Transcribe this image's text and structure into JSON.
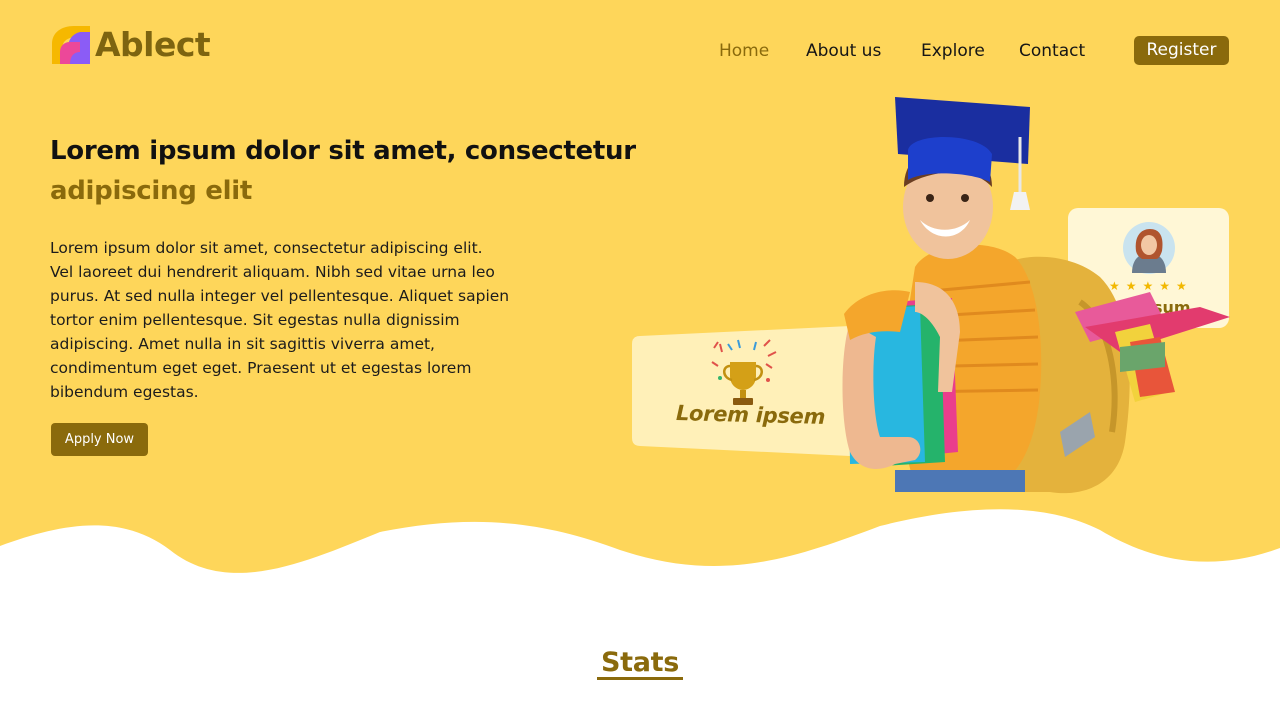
{
  "brand": {
    "name": "Ablect"
  },
  "nav": {
    "items": [
      {
        "label": "Home",
        "active": true
      },
      {
        "label": "About us",
        "active": false
      },
      {
        "label": "Explore",
        "active": false
      },
      {
        "label": "Contact",
        "active": false
      }
    ],
    "register_label": "Register"
  },
  "hero": {
    "title": "Lorem ipsum dolor sit amet, consectetur",
    "subtitle": "adipiscing elit",
    "body_lines": [
      "Lorem ipsum dolor sit amet, consectetur adipiscing elit.",
      "Vel laoreet dui hendrerit aliquam. Nibh sed vitae urna leo",
      "purus. At sed nulla integer vel pellentesque. Aliquet sapien",
      "tortor enim pellentesque. Sit egestas nulla dignissim",
      "adipiscing. Amet nulla in sit sagittis viverra amet,",
      "condimentum eget eget. Praesent ut et egestas lorem",
      "bibendum egestas."
    ],
    "apply_label": "Apply Now"
  },
  "illustration": {
    "award_card_text": "Lorem ipsem",
    "review_card_text": "ipsum",
    "review_stars": "★★★★★",
    "rating": 5
  },
  "stats": {
    "title": "Stats"
  },
  "colors": {
    "hero_background": "#fed65a",
    "accent": "#8a6a0c",
    "card_background": "#fff3c4",
    "star": "#f2b800"
  },
  "icons": [
    "logo-icon",
    "trophy-icon",
    "avatar",
    "star-icon"
  ]
}
